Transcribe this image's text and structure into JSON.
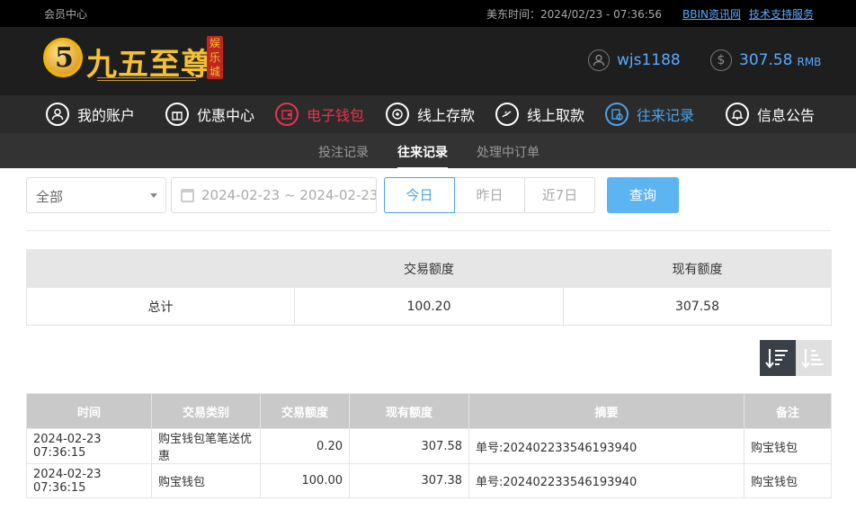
{
  "topbar": {
    "member_center": "会员中心",
    "time_label": "美东时间：2024/02/23 - 07:36:56",
    "link_info": "BBIN资讯网",
    "link_support": "技术支持服务"
  },
  "header": {
    "logo_mark": "5",
    "logo_text": "九五至尊",
    "logo_tag": "娱乐城",
    "username": "wjs1188",
    "balance": "307.58",
    "currency": "RMB",
    "icons": {
      "user": "user-circle-icon",
      "balance": "dollar-circle-icon"
    }
  },
  "nav": {
    "items": [
      {
        "label": "我的账户",
        "icon": "user-icon",
        "state": "normal"
      },
      {
        "label": "优惠中心",
        "icon": "gift-icon",
        "state": "normal"
      },
      {
        "label": "电子钱包",
        "icon": "wallet-icon",
        "state": "red"
      },
      {
        "label": "线上存款",
        "icon": "deposit-icon",
        "state": "normal"
      },
      {
        "label": "线上取款",
        "icon": "withdraw-icon",
        "state": "normal"
      },
      {
        "label": "往来记录",
        "icon": "records-icon",
        "state": "active"
      },
      {
        "label": "信息公告",
        "icon": "bell-icon",
        "state": "normal"
      }
    ]
  },
  "subnav": {
    "tabs": [
      {
        "label": "投注记录"
      },
      {
        "label": "往来记录",
        "active": true
      },
      {
        "label": "处理中订单"
      }
    ]
  },
  "filter": {
    "type_select": "全部",
    "date_range": "2024-02-23 ~ 2024-02-23",
    "quick": [
      "今日",
      "昨日",
      "近7日"
    ],
    "query_label": "查询"
  },
  "summary": {
    "col_amount": "交易额度",
    "col_balance": "现有额度",
    "row_label": "总计",
    "amount": "100.20",
    "balance": "307.58"
  },
  "records": {
    "columns": [
      "时间",
      "交易类别",
      "交易额度",
      "现有额度",
      "摘要",
      "备注"
    ],
    "rows": [
      [
        "2024-02-23 07:36:15",
        "购宝钱包笔笔送优惠",
        "0.20",
        "307.58",
        "单号:202402233546193940",
        "购宝钱包"
      ],
      [
        "2024-02-23 07:36:15",
        "购宝钱包",
        "100.00",
        "307.38",
        "单号:202402233546193940",
        "购宝钱包"
      ]
    ]
  },
  "colors": {
    "accent_blue": "#4aa3ea",
    "accent_red": "#e8344e",
    "logo_gold": "#f5c130"
  }
}
